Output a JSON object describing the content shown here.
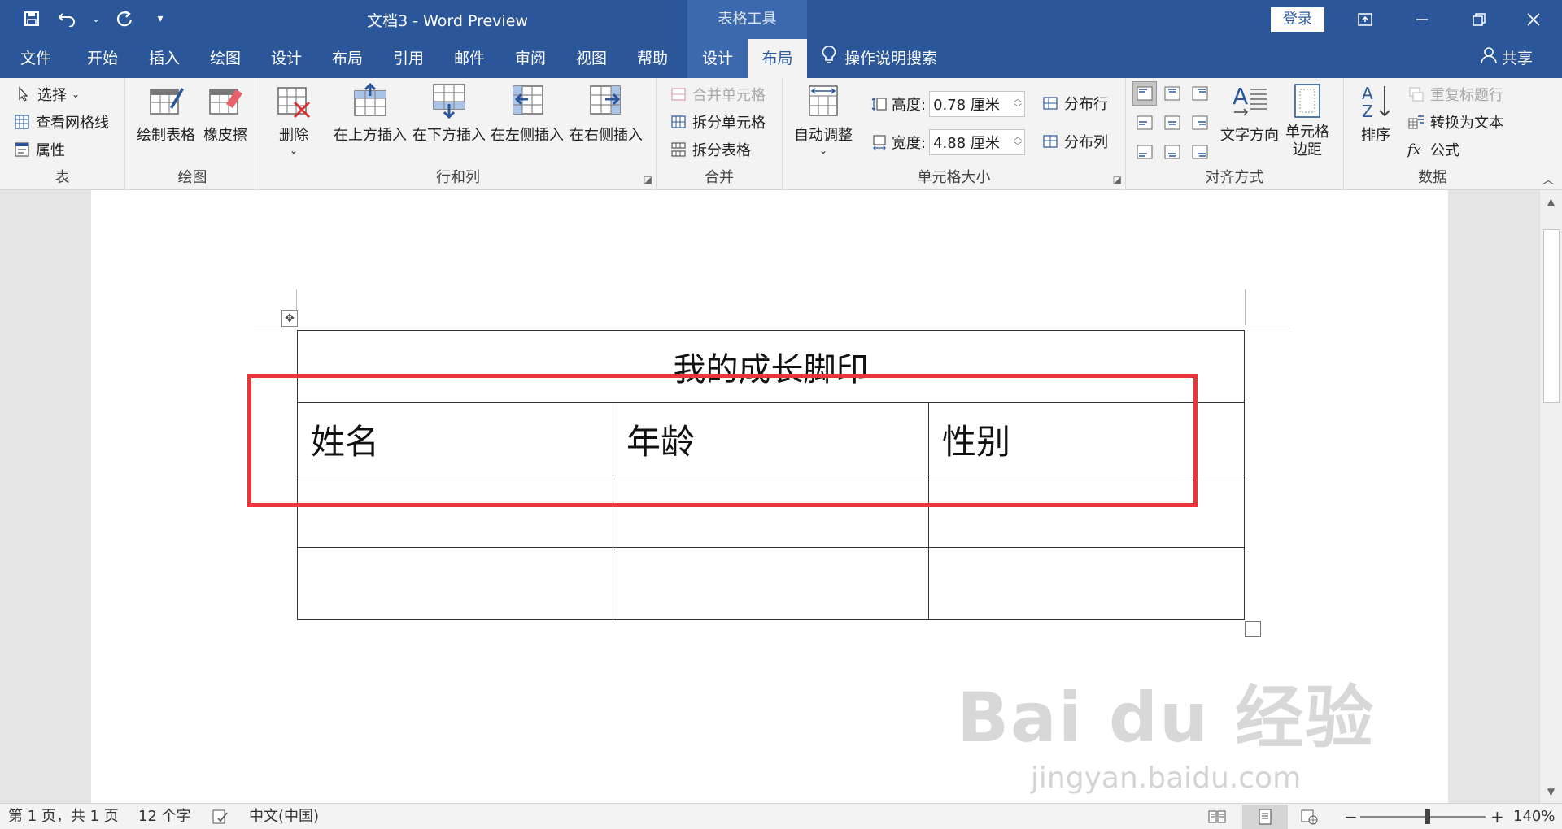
{
  "titlebar": {
    "doc_title": "文档3  -  Word Preview",
    "context_group": "表格工具",
    "login_label": "登录",
    "qat": {
      "save": "save-icon",
      "undo": "undo-icon",
      "redo": "redo-icon",
      "customize": "customize-icon"
    }
  },
  "tabs": [
    {
      "label": "文件"
    },
    {
      "label": "开始"
    },
    {
      "label": "插入"
    },
    {
      "label": "绘图"
    },
    {
      "label": "设计"
    },
    {
      "label": "布局"
    },
    {
      "label": "引用"
    },
    {
      "label": "邮件"
    },
    {
      "label": "审阅"
    },
    {
      "label": "视图"
    },
    {
      "label": "帮助"
    }
  ],
  "context_tabs": [
    {
      "label": "设计"
    },
    {
      "label": "布局"
    }
  ],
  "active_tab": "布局",
  "search_label": "操作说明搜索",
  "share_label": "共享",
  "ribbon": {
    "table_group": {
      "label": "表",
      "select": "选择",
      "gridlines": "查看网格线",
      "properties": "属性"
    },
    "draw_group": {
      "label": "绘图",
      "draw_table": "绘制表格",
      "eraser": "橡皮擦"
    },
    "rows_cols_group": {
      "label": "行和列",
      "delete": "删除",
      "insert_above": "在上方插入",
      "insert_below": "在下方插入",
      "insert_left": "在左侧插入",
      "insert_right": "在右侧插入"
    },
    "merge_group": {
      "label": "合并",
      "merge_cells": "合并单元格",
      "split_cells": "拆分单元格",
      "split_table": "拆分表格"
    },
    "cell_size_group": {
      "label": "单元格大小",
      "autofit": "自动调整",
      "height_label": "高度:",
      "height_value": "0.78 厘米",
      "width_label": "宽度:",
      "width_value": "4.88 厘米",
      "distribute_rows": "分布行",
      "distribute_cols": "分布列"
    },
    "alignment_group": {
      "label": "对齐方式",
      "text_direction": "文字方向",
      "cell_margins_1": "单元格",
      "cell_margins_2": "边距"
    },
    "data_group": {
      "label": "数据",
      "sort": "排序",
      "repeat_header": "重复标题行",
      "convert_text": "转换为文本",
      "formula": "公式"
    }
  },
  "document": {
    "table_title": "我的成长脚印",
    "headers": [
      "姓名",
      "年龄",
      "性别"
    ],
    "empty_rows": 2,
    "watermark_main": "Bai du 经验",
    "watermark_sub": "jingyan.baidu.com"
  },
  "statusbar": {
    "page_info": "第 1 页，共 1 页",
    "word_count": "12 个字",
    "language": "中文(中国)",
    "zoom_minus": "−",
    "zoom_plus": "+",
    "zoom_level": "140%"
  },
  "colors": {
    "accent": "#2b579a",
    "highlight_box": "#e8363a"
  }
}
